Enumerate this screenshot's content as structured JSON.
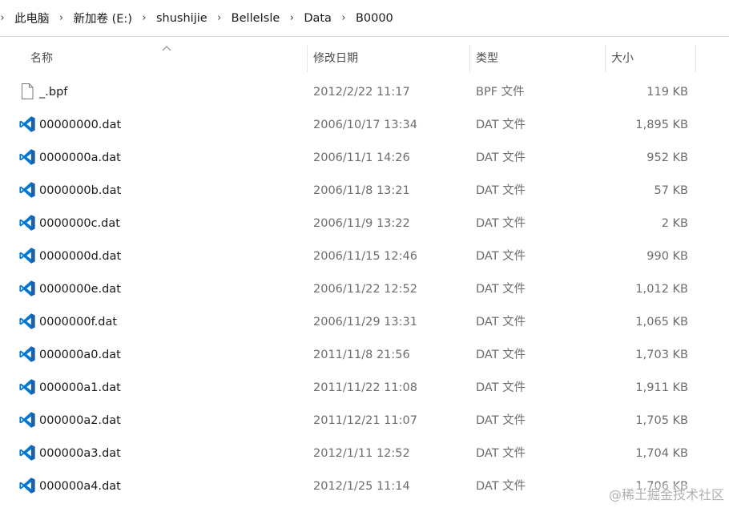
{
  "breadcrumb": {
    "items": [
      "此电脑",
      "新加卷 (E:)",
      "shushijie",
      "BelleIsle",
      "Data",
      "B0000"
    ],
    "separator": "›"
  },
  "columns": {
    "name": "名称",
    "modified": "修改日期",
    "type": "类型",
    "size": "大小"
  },
  "files": [
    {
      "name": "_.bpf",
      "modified": "2012/2/22 11:17",
      "type": "BPF 文件",
      "size": "119 KB",
      "icon": "generic-file-icon"
    },
    {
      "name": "00000000.dat",
      "modified": "2006/10/17 13:34",
      "type": "DAT 文件",
      "size": "1,895 KB",
      "icon": "vscode-icon"
    },
    {
      "name": "0000000a.dat",
      "modified": "2006/11/1 14:26",
      "type": "DAT 文件",
      "size": "952 KB",
      "icon": "vscode-icon"
    },
    {
      "name": "0000000b.dat",
      "modified": "2006/11/8 13:21",
      "type": "DAT 文件",
      "size": "57 KB",
      "icon": "vscode-icon"
    },
    {
      "name": "0000000c.dat",
      "modified": "2006/11/9 13:22",
      "type": "DAT 文件",
      "size": "2 KB",
      "icon": "vscode-icon"
    },
    {
      "name": "0000000d.dat",
      "modified": "2006/11/15 12:46",
      "type": "DAT 文件",
      "size": "990 KB",
      "icon": "vscode-icon"
    },
    {
      "name": "0000000e.dat",
      "modified": "2006/11/22 12:52",
      "type": "DAT 文件",
      "size": "1,012 KB",
      "icon": "vscode-icon"
    },
    {
      "name": "0000000f.dat",
      "modified": "2006/11/29 13:31",
      "type": "DAT 文件",
      "size": "1,065 KB",
      "icon": "vscode-icon"
    },
    {
      "name": "000000a0.dat",
      "modified": "2011/11/8 21:56",
      "type": "DAT 文件",
      "size": "1,703 KB",
      "icon": "vscode-icon"
    },
    {
      "name": "000000a1.dat",
      "modified": "2011/11/22 11:08",
      "type": "DAT 文件",
      "size": "1,911 KB",
      "icon": "vscode-icon"
    },
    {
      "name": "000000a2.dat",
      "modified": "2011/12/21 11:07",
      "type": "DAT 文件",
      "size": "1,705 KB",
      "icon": "vscode-icon"
    },
    {
      "name": "000000a3.dat",
      "modified": "2012/1/11 12:52",
      "type": "DAT 文件",
      "size": "1,704 KB",
      "icon": "vscode-icon"
    },
    {
      "name": "000000a4.dat",
      "modified": "2012/1/25 11:14",
      "type": "DAT 文件",
      "size": "1,706 KB",
      "icon": "vscode-icon"
    }
  ],
  "watermark": "@稀土掘金技术社区",
  "colors": {
    "vscode_blue": "#0078d7",
    "vscode_blue_dark": "#1f5fa8",
    "text_primary": "#1a1a1a",
    "text_secondary": "#6d6d6d"
  }
}
